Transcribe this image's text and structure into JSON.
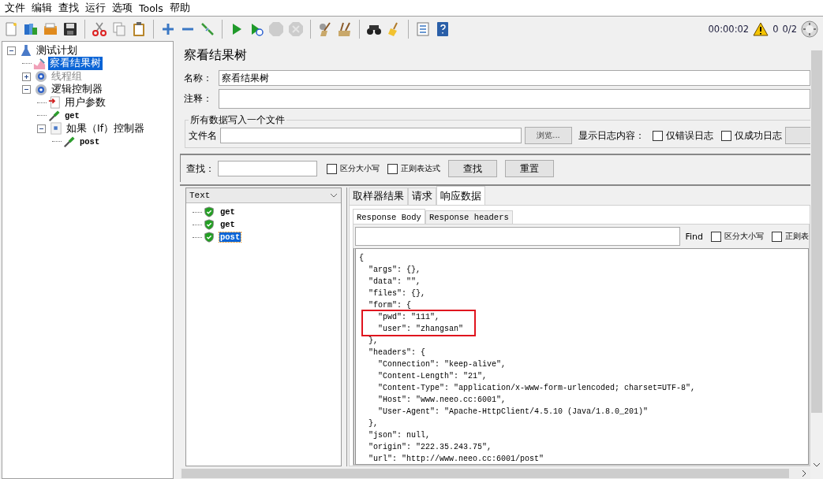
{
  "menu": [
    "文件",
    "编辑",
    "查找",
    "运行",
    "选项",
    "Tools",
    "帮助"
  ],
  "toolbar": [
    [
      {
        "kind": "new",
        "disabled": false
      },
      {
        "kind": "templates",
        "disabled": false
      },
      {
        "kind": "open",
        "disabled": false
      },
      {
        "kind": "save",
        "disabled": false
      }
    ],
    [
      {
        "kind": "cut",
        "disabled": false
      },
      {
        "kind": "copy",
        "disabled": false
      },
      {
        "kind": "paste",
        "disabled": false
      }
    ],
    [
      {
        "kind": "expand",
        "disabled": false
      },
      {
        "kind": "collapse",
        "disabled": false
      },
      {
        "kind": "toggle",
        "disabled": false
      }
    ],
    [
      {
        "kind": "start",
        "disabled": false
      },
      {
        "kind": "start_no_pauses",
        "disabled": false
      },
      {
        "kind": "stop",
        "disabled": true
      },
      {
        "kind": "shutdown",
        "disabled": true
      }
    ],
    [
      {
        "kind": "clear",
        "disabled": false
      },
      {
        "kind": "clear_all",
        "disabled": false
      }
    ],
    [
      {
        "kind": "search",
        "disabled": false
      },
      {
        "kind": "reset_search",
        "disabled": false
      }
    ],
    [
      {
        "kind": "function_helper",
        "disabled": false
      },
      {
        "kind": "help",
        "disabled": false
      }
    ]
  ],
  "status": {
    "elapsed": "00:00:02",
    "warnings": "0",
    "threads": "0/2"
  },
  "tree": [
    {
      "label": "测试计划",
      "kind": "plan",
      "selected": false,
      "disabled": false,
      "expanded": true,
      "children": [
        {
          "label": "察看结果树",
          "kind": "listener",
          "selected": true,
          "disabled": false
        },
        {
          "label": "线程组",
          "kind": "threadgroup",
          "selected": false,
          "disabled": true,
          "expanded": false
        },
        {
          "label": "逻辑控制器",
          "kind": "controller",
          "selected": false,
          "disabled": false,
          "expanded": true,
          "children": [
            {
              "label": "用户参数",
              "kind": "preprocessor",
              "selected": false,
              "disabled": false
            },
            {
              "label": "get",
              "kind": "sampler",
              "selected": false,
              "disabled": false
            },
            {
              "label": "如果（If）控制器",
              "kind": "if",
              "selected": false,
              "disabled": false,
              "expanded": true,
              "children": [
                {
                  "label": "post",
                  "kind": "sampler",
                  "selected": false,
                  "disabled": false
                }
              ]
            }
          ]
        }
      ]
    }
  ],
  "panel": {
    "title": "察看结果树",
    "name_label": "名称：",
    "name_value": "察看结果树",
    "comment_label": "注释：",
    "file_group": {
      "title": "所有数据写入一个文件",
      "file_label": "文件名",
      "browse": "浏览...",
      "log_label": "显示日志内容：",
      "checkboxes": [
        {
          "label": "仅错误日志",
          "checked": false
        },
        {
          "label": "仅成功日志",
          "checked": false
        }
      ]
    },
    "search": {
      "label": "查找：",
      "checkboxes": [
        {
          "label": "区分大小写",
          "checked": false
        },
        {
          "label": "正则表达式",
          "checked": false
        }
      ],
      "buttons": [
        "查找",
        "重置"
      ]
    }
  },
  "results": {
    "renderer": "Text",
    "items": [
      {
        "label": "get",
        "selected": false
      },
      {
        "label": "get",
        "selected": false
      },
      {
        "label": "post",
        "selected": true
      }
    ]
  },
  "tabs": [
    {
      "label": "取样器结果",
      "selected": false
    },
    {
      "label": "请求",
      "selected": false
    },
    {
      "label": "响应数据",
      "selected": true
    }
  ],
  "subtabs": [
    {
      "label": "Response Body",
      "selected": true
    },
    {
      "label": "Response headers",
      "selected": false
    }
  ],
  "find": {
    "label": "Find",
    "checkboxes": [
      {
        "label": "区分大小写",
        "checked": false
      },
      {
        "label": "正则表",
        "checked": false
      }
    ]
  },
  "body": [
    {
      "text": "{",
      "highlighted": false
    },
    {
      "text": "  \"args\": {},",
      "highlighted": false
    },
    {
      "text": "  \"data\": \"\",",
      "highlighted": false
    },
    {
      "text": "  \"files\": {},",
      "highlighted": false
    },
    {
      "text": "  \"form\": {",
      "highlighted": false
    },
    {
      "text": "    \"pwd\": \"111\",",
      "highlighted": true
    },
    {
      "text": "    \"user\": \"zhangsan\"",
      "highlighted": true
    },
    {
      "text": "  },",
      "highlighted": false
    },
    {
      "text": "  \"headers\": {",
      "highlighted": false
    },
    {
      "text": "    \"Connection\": \"keep-alive\",",
      "highlighted": false
    },
    {
      "text": "    \"Content-Length\": \"21\",",
      "highlighted": false
    },
    {
      "text": "    \"Content-Type\": \"application/x-www-form-urlencoded; charset=UTF-8\",",
      "highlighted": false
    },
    {
      "text": "    \"Host\": \"www.neeo.cc:6001\",",
      "highlighted": false
    },
    {
      "text": "    \"User-Agent\": \"Apache-HttpClient/4.5.10 (Java/1.8.0_201)\"",
      "highlighted": false
    },
    {
      "text": "  },",
      "highlighted": false
    },
    {
      "text": "  \"json\": null,",
      "highlighted": false
    },
    {
      "text": "  \"origin\": \"222.35.243.75\",",
      "highlighted": false
    },
    {
      "text": "  \"url\": \"http://www.neeo.cc:6001/post\"",
      "highlighted": false
    }
  ]
}
